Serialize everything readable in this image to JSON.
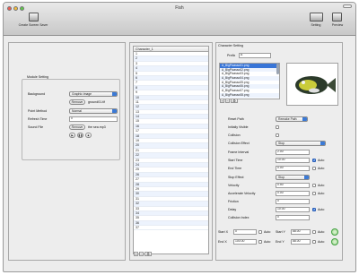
{
  "window": {
    "title": "Fish",
    "toolbar": {
      "left_label": "Create Screen Saver",
      "right_labels": [
        "Setting",
        "Preview"
      ]
    }
  },
  "module": {
    "heading": "Module Setting",
    "background_label": "Background",
    "background_value": "Graphic image",
    "remove_label": "Remove",
    "background_file": "ground01.tif",
    "point_method_label": "Point Method",
    "point_method_value": "Normal",
    "refresh_label": "Refresh Time",
    "refresh_value": "0",
    "sound_label": "Sound File",
    "sound_remove": "Remove",
    "sound_file": "the sea.mp3"
  },
  "characters": {
    "header": "Character_1",
    "rows": [
      "1",
      "2",
      "3",
      "4",
      "5",
      "6",
      "7",
      "8",
      "9",
      "10",
      "11",
      "12",
      "13",
      "14",
      "15",
      "16",
      "17",
      "18",
      "19",
      "20",
      "21",
      "22",
      "23",
      "24",
      "25",
      "26",
      "27",
      "28",
      "29",
      "30",
      "31",
      "32",
      "33",
      "34",
      "35",
      "36",
      "37"
    ]
  },
  "setting": {
    "heading": "Character Setting",
    "prefix_label": "Prefix",
    "prefix_value": "A",
    "files": [
      "A_BigPicasso01.png",
      "A_BigPicasso02.png",
      "A_BigPicasso03.png",
      "A_BigPicasso04.png",
      "A_BigPicasso05.png",
      "A_BigPicasso06.png",
      "A_BigPicasso07.png",
      "A_BigPicasso08.png"
    ],
    "selected_file_index": 0,
    "reset_path_label": "Reset Path",
    "reset_path_value": "Remake Path",
    "initially_visible_label": "Initially Visible",
    "collision_label": "Collision",
    "collision_effect_label": "Collision Effect",
    "collision_effect_value": "Stop",
    "frame_interval_label": "Frame Interval",
    "frame_interval_value": "2.00",
    "start_time_label": "Start Time",
    "start_time_value": "10.00",
    "end_time_label": "End Time",
    "end_time_value": "0.00",
    "stop_effect_label": "Stop Effect",
    "stop_effect_value": "Stop",
    "velocity_label": "Velocity",
    "velocity_value": "0.50",
    "accel_label": "Accelerate Velocity",
    "accel_value": "0.00",
    "friction_label": "Friction",
    "friction_value": "0",
    "delay_label": "Delay",
    "delay_value": "10.00",
    "collision_index_label": "Collision Index",
    "collision_index_value": "0",
    "auto_label": "Auto",
    "start_x_label": "Start X",
    "start_x_value": "0",
    "start_y_label": "Start Y",
    "start_y_value": "88.00",
    "end_x_label": "End X",
    "end_x_value": "100.00",
    "end_y_label": "End Y",
    "end_y_value": "88.00"
  }
}
